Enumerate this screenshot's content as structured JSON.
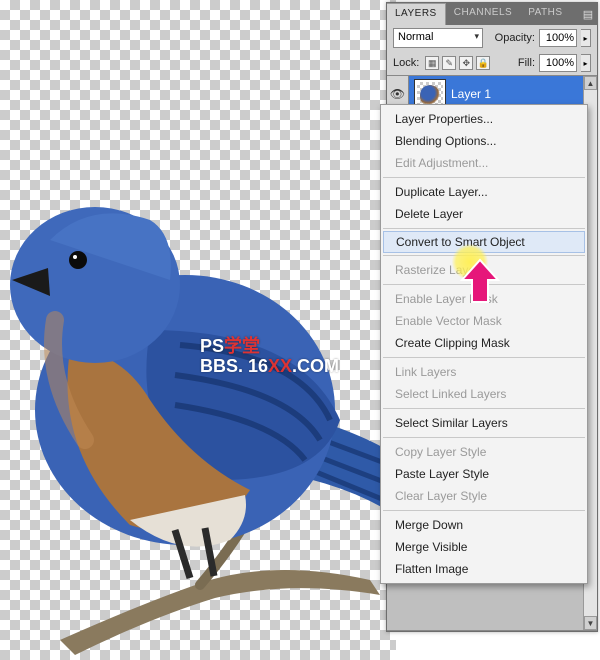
{
  "watermark": {
    "line1_a": "PS",
    "line1_b": "学堂",
    "line2_a": "BBS. 16",
    "line2_b": "XX",
    "line2_c": ".COM"
  },
  "panel": {
    "tabs": {
      "layers": "LAYERS",
      "channels": "CHANNELS",
      "paths": "PATHS"
    },
    "blend_mode": "Normal",
    "opacity_label": "Opacity:",
    "opacity_value": "100%",
    "lock_label": "Lock:",
    "fill_label": "Fill:",
    "fill_value": "100%",
    "layer_name": "Layer 1"
  },
  "context_menu": {
    "layer_properties": "Layer Properties...",
    "blending_options": "Blending Options...",
    "edit_adjustment": "Edit Adjustment...",
    "duplicate_layer": "Duplicate Layer...",
    "delete_layer": "Delete Layer",
    "convert_smart": "Convert to Smart Object",
    "rasterize_layer": "Rasterize Layer",
    "enable_layer_mask": "Enable Layer Mask",
    "enable_vector_mask": "Enable Vector Mask",
    "create_clipping_mask": "Create Clipping Mask",
    "link_layers": "Link Layers",
    "select_linked": "Select Linked Layers",
    "select_similar": "Select Similar Layers",
    "copy_layer_style": "Copy Layer Style",
    "paste_layer_style": "Paste Layer Style",
    "clear_layer_style": "Clear Layer Style",
    "merge_down": "Merge Down",
    "merge_visible": "Merge Visible",
    "flatten_image": "Flatten Image"
  }
}
